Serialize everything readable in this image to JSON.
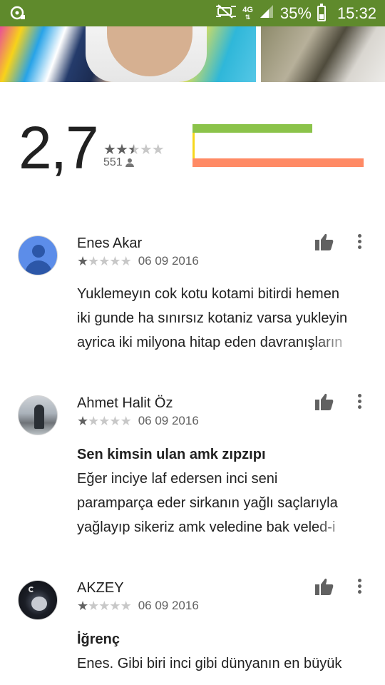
{
  "status_bar": {
    "network": "4G",
    "battery": "35%",
    "battery_level": 0.35,
    "time": "15:32",
    "icons": [
      "media-icon",
      "mute-icon",
      "signal-icon",
      "battery-icon"
    ]
  },
  "summary": {
    "rating": "2,7",
    "rating_stars": 2.5,
    "count": "551",
    "bars": [
      {
        "color": "#8bc34a",
        "fraction": 0.7
      },
      {
        "color": "#ff8a65",
        "fraction": 1.0
      }
    ]
  },
  "reviews": [
    {
      "name": "Enes Akar",
      "stars": 1,
      "date": "06 09 2016",
      "title": "",
      "body": [
        "Yuklemeyın cok kotu kotami bitirdi hemen",
        "iki gunde ha sınırsız kotaniz varsa yukleyin",
        "ayrica iki milyona hitap eden davranışların"
      ]
    },
    {
      "name": "Ahmet Halit Öz",
      "stars": 1,
      "date": "06 09 2016",
      "title": "Sen kimsin ulan amk zıpzıpı",
      "body": [
        "Eğer inciye laf edersen inci seni",
        "paramparça eder sirkanın yağlı saçlarıyla",
        "yağlayıp sikeriz amk veledine bak veled-i"
      ]
    },
    {
      "name": "AKZEY",
      "stars": 1,
      "date": "06 09 2016",
      "title": "İğrenç",
      "body": [
        "Enes. Gibi biri inci gibi dünyanın en büyük"
      ]
    }
  ],
  "icons": {
    "thumb": "thumb-up-icon",
    "more": "more-vert-icon",
    "star_full": "★",
    "star_empty": "★"
  }
}
